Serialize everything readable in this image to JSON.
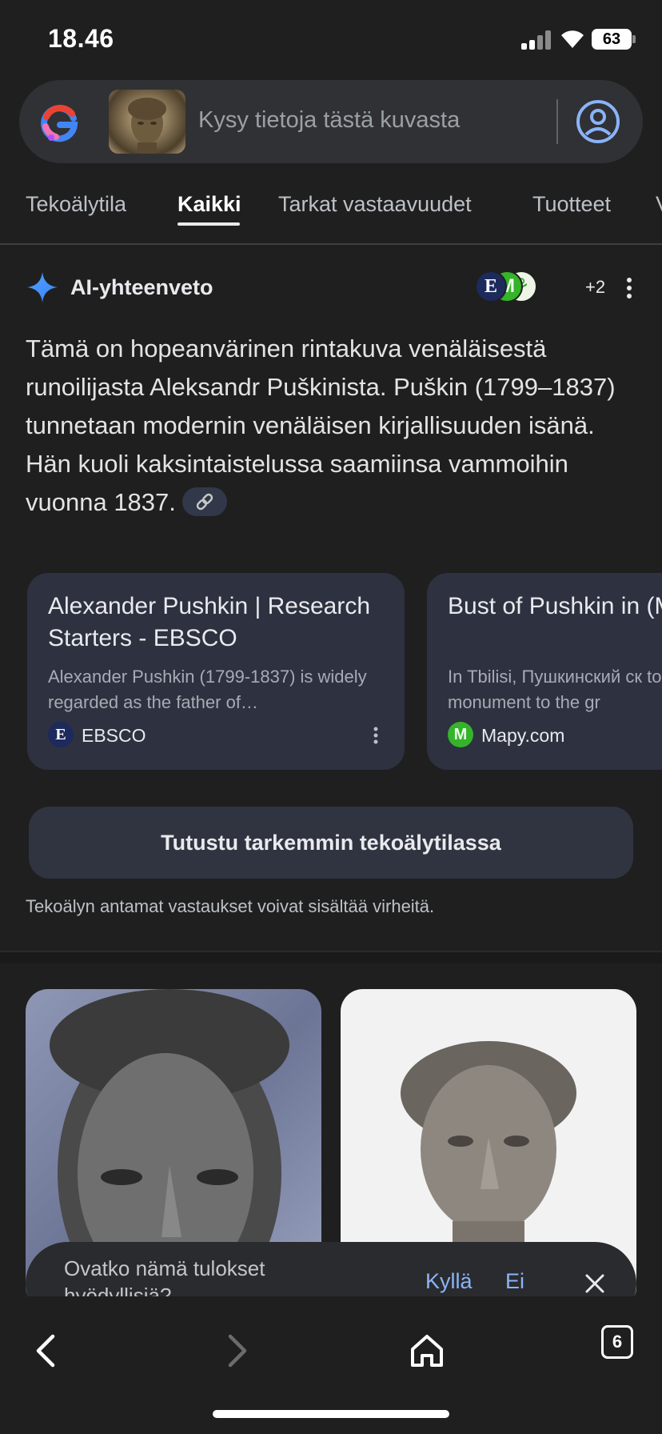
{
  "status_bar": {
    "time": "18.46",
    "battery": "63"
  },
  "search": {
    "placeholder": "Kysy tietoja tästä kuvasta",
    "logo_icon": "google-lens-g-icon",
    "account_icon": "account-circle-icon"
  },
  "tabs": [
    {
      "label": "Tekoälytila",
      "active": false
    },
    {
      "label": "Kaikki",
      "active": true
    },
    {
      "label": "Tarkat vastaavuudet",
      "active": false
    },
    {
      "label": "Tuotteet",
      "active": false
    },
    {
      "label": "V",
      "active": false
    }
  ],
  "ai_overview": {
    "title": "AI-yhteenveto",
    "source_avatars": [
      "E",
      "M",
      "⚘"
    ],
    "more_sources": "+2",
    "text": "Tämä on hopeanvärinen rintakuva venäläisestä runoilijasta Aleksandr Puškinista. Puškin (1799–1837) tunnetaan modernin venäläisen kirjallisuuden isänä. Hän kuoli kaksintaistelussa saamiinsa vammoihin vuonna 1837."
  },
  "source_cards": [
    {
      "title": "Alexander Pushkin | Research Starters - EBSCO",
      "snippet": "Alexander Pushkin (1799-1837) is widely regarded as the father of…",
      "source": "EBSCO",
      "source_initial": "E"
    },
    {
      "title": "Bust of Pushkin in (Monument, memo",
      "snippet": "In Tbilisi, Пушкинский ск to a monument to the gr",
      "source": "Mapy.com",
      "source_initial": "M"
    }
  ],
  "deeper_button": "Tutustu tarkemmin tekoälytilassa",
  "disclaimer": "Tekoälyn antamat vastaukset voivat sisältää virheitä.",
  "feedback": {
    "question": "Ovatko nämä tulokset hyödyllisiä?",
    "yes": "Kyllä",
    "no": "Ei"
  },
  "bottom_nav": {
    "tab_count": "6"
  },
  "colors": {
    "background": "#1f1f1f",
    "accent_link": "#8ab4f8",
    "card": "#2e3140"
  }
}
